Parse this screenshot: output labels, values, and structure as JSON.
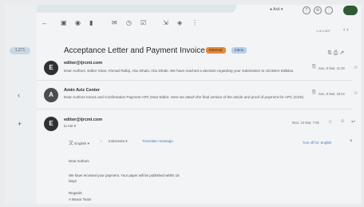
{
  "rail": {
    "badge": "1,271"
  },
  "top": {
    "status": "Acti"
  },
  "toolbar": {
    "icons": [
      "back-arrow-icon",
      "archive-icon",
      "report-icon",
      "delete-icon",
      "mark-unread-icon",
      "snooze-icon",
      "task-icon",
      "move-icon",
      "label-icon",
      "more-icon"
    ]
  },
  "pager": {
    "text": "1 of 1,507"
  },
  "thread": {
    "subject": "Acceptance Letter and Payment Invoice",
    "labels": [
      {
        "text": "External",
        "color": "#e08a3c"
      },
      {
        "text": "Inbox",
        "color": "#b9cde8"
      }
    ]
  },
  "messages": [
    {
      "avatar": "E",
      "sender": "editor@ijrcmi.com",
      "snippet": "Dear Authors, Editor Sinar, Ahmad Rafiqi, Abu Dhabi, Abu Dhabi. We have reached a decision regarding your submission to IJCSMAI Ediblea",
      "date": "Sun, 9 Mar, 11:48"
    },
    {
      "avatar": "A",
      "sender": "Amin Aziz Center",
      "snippet": "Dear Authors Iranus and Confirmation Payment APC Dear Editor. Here we attach the final version of the article and proof of payment for APC (CDS)",
      "date": "Sun, 9 Mar, 18:51"
    },
    {
      "avatar": "E",
      "sender": "editor@ijrcmi.com",
      "recipient": "to me",
      "date": "Mon, 10 Mar, 7:06"
    }
  ],
  "translate": {
    "from": "English",
    "to": "Indonesia",
    "action": "Translate message",
    "right": "Turn off for: English"
  },
  "body": {
    "greeting": "Dear Authors",
    "line1": "We have received your payment. Your paper will be published within 15",
    "line2": "Days",
    "closing": "Regards",
    "signature": "A Wusur Team"
  }
}
